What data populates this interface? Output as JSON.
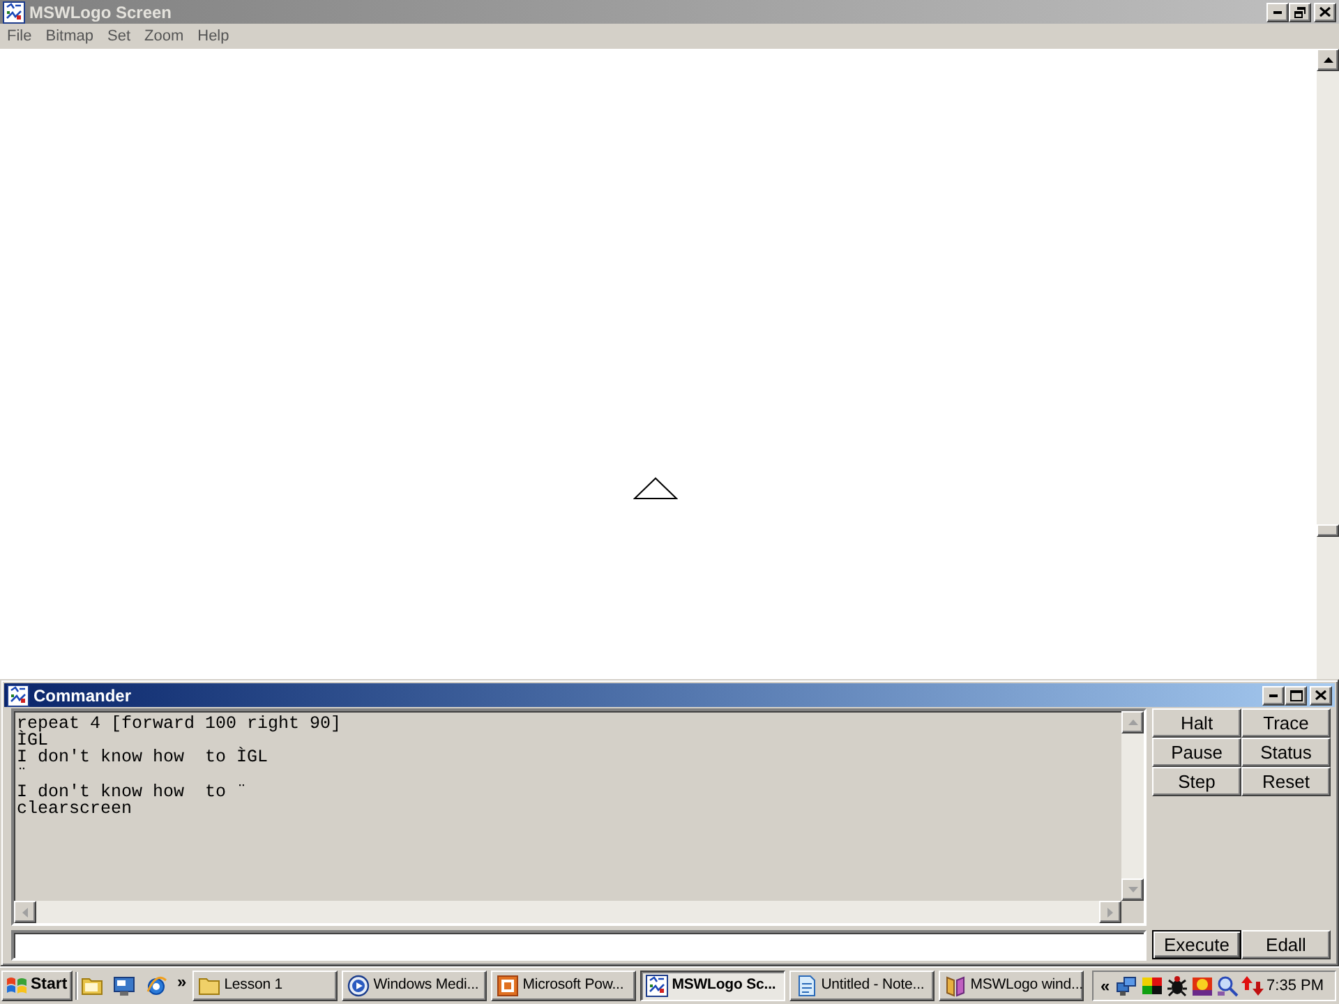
{
  "window": {
    "title": "MSWLogo Screen",
    "active": false
  },
  "menu": [
    "File",
    "Bitmap",
    "Set",
    "Zoom",
    "Help"
  ],
  "commander": {
    "title": "Commander",
    "active": true,
    "output": [
      "repeat 4 [forward 100 right 90]",
      "ÌGL",
      "I don't know how  to ÌGL",
      "¨",
      "I don't know how  to ¨",
      "clearscreen"
    ],
    "buttons": [
      "Halt",
      "Trace",
      "Pause",
      "Status",
      "Step",
      "Reset"
    ],
    "actions": [
      {
        "label": "Execute",
        "default": true
      },
      {
        "label": "Edall",
        "default": false
      }
    ]
  },
  "taskbar": {
    "start": "Start",
    "more": "»",
    "tasks": [
      {
        "label": "Lesson 1",
        "kind": "folder",
        "selected": false
      },
      {
        "label": "Windows Medi...",
        "kind": "player",
        "selected": false
      },
      {
        "label": "Microsoft Pow...",
        "kind": "slides",
        "selected": false
      },
      {
        "label": "MSWLogo Sc...",
        "kind": "logo",
        "selected": true
      },
      {
        "label": "Untitled - Note...",
        "kind": "notepad",
        "selected": false
      },
      {
        "label": "MSWLogo wind...",
        "kind": "book",
        "selected": false
      }
    ],
    "tray_expand": "«",
    "clock": "7:35 PM"
  }
}
